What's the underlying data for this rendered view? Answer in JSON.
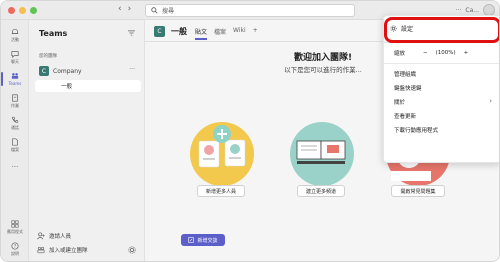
{
  "colors": {
    "accent": "#5b5fc7",
    "team_badge": "#397b73",
    "highlight": "#e01010"
  },
  "titlebar": {
    "search_placeholder": "搜尋",
    "partial_name": "Ca...",
    "more": "···"
  },
  "rail": [
    {
      "label": "活動",
      "icon": "bell-icon"
    },
    {
      "label": "聊天",
      "icon": "chat-icon"
    },
    {
      "label": "Teams",
      "icon": "teams-icon",
      "active": true
    },
    {
      "label": "作業",
      "icon": "assignments-icon"
    },
    {
      "label": "通話",
      "icon": "phone-icon"
    },
    {
      "label": "檔案",
      "icon": "file-icon"
    },
    {
      "label": "···",
      "icon": "more-icon"
    },
    {
      "label": "應用程式",
      "icon": "apps-icon"
    },
    {
      "label": "說明",
      "icon": "help-icon"
    }
  ],
  "teams_panel": {
    "title": "Teams",
    "section": "您的團隊",
    "team_badge": "C",
    "team_name": "Company",
    "team_more": "···",
    "channel": "一般",
    "invite": "邀請人員",
    "join": "加入或建立團隊"
  },
  "main": {
    "channel_badge": "C",
    "channel_name": "一般",
    "tabs": [
      "貼文",
      "檔案",
      "Wiki"
    ],
    "add_tab": "+",
    "welcome_title": "歡迎加入團隊!",
    "welcome_sub": "以下是您可以進行的作業...",
    "cards": [
      "新增更多人員",
      "建立更多頻道",
      "開啟常見問題集"
    ],
    "new_conversation": "新增交談"
  },
  "menu": {
    "settings": "設定",
    "zoom_label": "縮放",
    "zoom_minus": "−",
    "zoom_value": "(100%)",
    "zoom_plus": "+",
    "items": [
      "管理組織",
      "鍵盤快速鍵",
      "關於",
      "查看更新",
      "下載行動應用程式"
    ],
    "about_chevron": "›"
  }
}
